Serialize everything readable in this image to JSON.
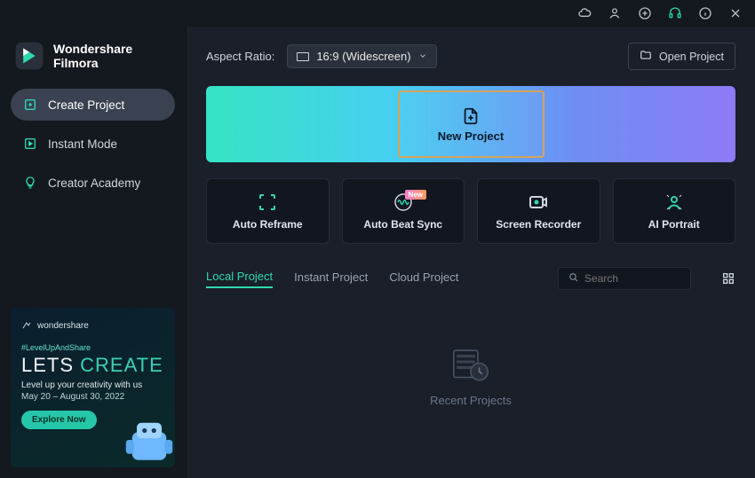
{
  "brand": {
    "line1": "Wondershare",
    "line2": "Filmora"
  },
  "sidebar": {
    "items": [
      {
        "label": "Create Project"
      },
      {
        "label": "Instant Mode"
      },
      {
        "label": "Creator Academy"
      }
    ]
  },
  "promo": {
    "brand": "wondershare",
    "tag": "#LevelUpAndShare",
    "title_part1": "LETS ",
    "title_part2": "CREATE",
    "copy": "Level up your creativity with us",
    "dates": "May 20 – August 30, 2022",
    "button": "Explore Now"
  },
  "toolbar": {
    "aspect_label": "Aspect Ratio:",
    "aspect_value": "16:9 (Widescreen)",
    "open_label": "Open Project"
  },
  "hero": {
    "new_project": "New Project"
  },
  "features": [
    {
      "label": "Auto Reframe"
    },
    {
      "label": "Auto Beat Sync",
      "badge": "New"
    },
    {
      "label": "Screen Recorder"
    },
    {
      "label": "AI Portrait"
    }
  ],
  "tabs": [
    {
      "label": "Local Project"
    },
    {
      "label": "Instant Project"
    },
    {
      "label": "Cloud Project"
    }
  ],
  "search": {
    "placeholder": "Search"
  },
  "empty": {
    "label": "Recent Projects"
  }
}
